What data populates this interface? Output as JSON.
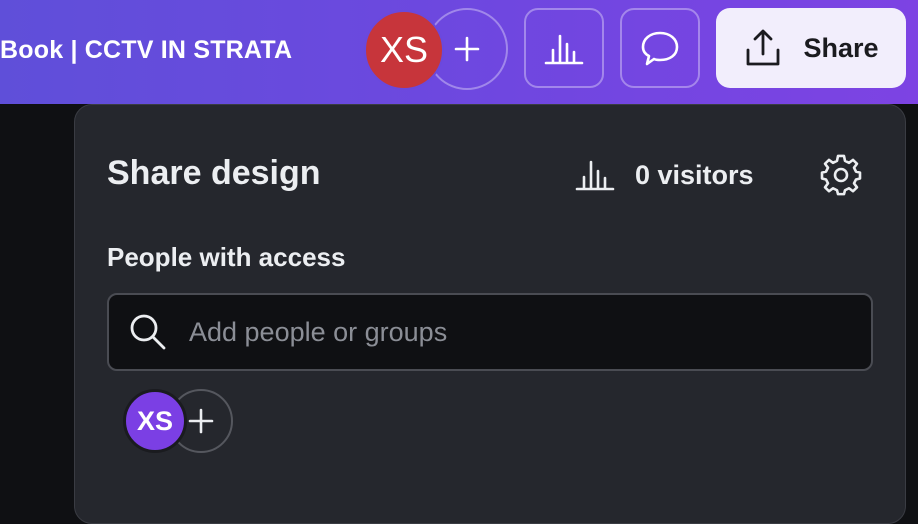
{
  "header": {
    "doc_title": "Book | CCTV IN STRATA",
    "collaborator_initials": "XS",
    "share_label": "Share"
  },
  "share_panel": {
    "title": "Share design",
    "visitors_label": "0 visitors",
    "people_section_label": "People with access",
    "search_placeholder": "Add people or groups",
    "member_initials": "XS"
  },
  "colors": {
    "header_gradient_start": "#5f4fd9",
    "header_gradient_end": "#7d43e3",
    "panel_bg": "#25272d",
    "collaborator_avatar": "#c7353b",
    "member_avatar": "#7b3fe4",
    "share_button_bg": "#f2eefc"
  },
  "icons": {
    "add": "plus-icon",
    "insights": "bar-chart-icon",
    "comments": "speech-bubble-icon",
    "share": "upload-icon",
    "settings": "gear-icon",
    "search": "magnifier-icon"
  }
}
